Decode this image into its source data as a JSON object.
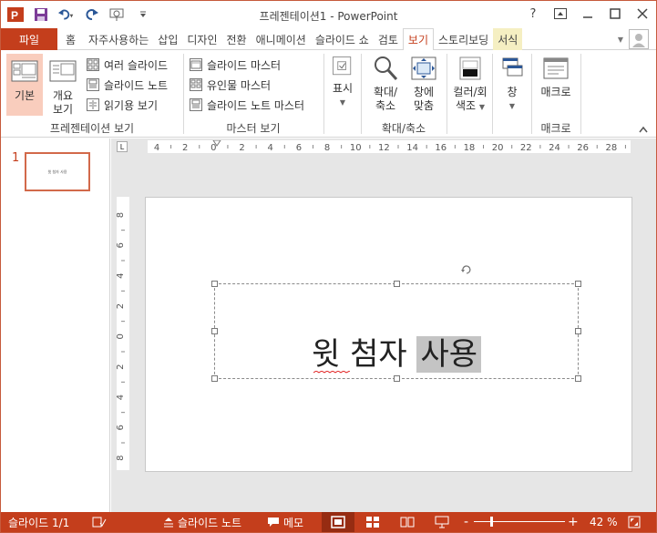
{
  "window": {
    "title": "프레젠테이션1 - PowerPoint",
    "help": "?",
    "controls": [
      "restore-ribbon",
      "minimize",
      "maximize",
      "close"
    ]
  },
  "tabs": {
    "file": "파일",
    "items": [
      {
        "label": "홈"
      },
      {
        "label": "자주사용하는"
      },
      {
        "label": "삽입"
      },
      {
        "label": "디자인"
      },
      {
        "label": "전환"
      },
      {
        "label": "애니메이션"
      },
      {
        "label": "슬라이드 쇼"
      },
      {
        "label": "검토"
      },
      {
        "label": "보기"
      },
      {
        "label": "스토리보딩"
      },
      {
        "label": "서식"
      }
    ],
    "active_index": 8
  },
  "ribbon": {
    "presentation_views": {
      "label": "프레젠테이션 보기",
      "normal": "기본",
      "outline_1": "개요",
      "outline_2": "보기",
      "slide_sorter": "여러 슬라이드",
      "notes_page": "슬라이드 노트",
      "reading_view": "읽기용 보기"
    },
    "master_views": {
      "label": "마스터 보기",
      "slide_master": "슬라이드 마스터",
      "handout_master": "유인물 마스터",
      "notes_master": "슬라이드 노트 마스터"
    },
    "show": {
      "label": "표시"
    },
    "zoom": {
      "label": "확대/축소",
      "zoom_1": "확대/",
      "zoom_2": "축소",
      "fit_1": "창에",
      "fit_2": "맞춤"
    },
    "color": {
      "label_1": "컬러/회",
      "label_2": "색조"
    },
    "window": {
      "label": "창"
    },
    "macros": {
      "button": "매크로",
      "label": "매크로"
    }
  },
  "slides_panel": {
    "number": "1",
    "thumb_text": "윗 첨자 사용"
  },
  "ruler": {
    "h_ticks": [
      "4",
      "2",
      "0",
      "2",
      "4",
      "6",
      "8",
      "10",
      "12",
      "14",
      "16",
      "18",
      "20",
      "22",
      "24",
      "26",
      "28"
    ],
    "v_ticks": [
      "8",
      "6",
      "4",
      "2",
      "0",
      "2",
      "4",
      "6",
      "8"
    ]
  },
  "slide": {
    "text_part1": "윗",
    "text_part2": "첨자",
    "text_part3": "사용"
  },
  "status": {
    "slide_count": "슬라이드 1/1",
    "notes": "슬라이드 노트",
    "comments": "메모",
    "zoom_minus": "-",
    "zoom_plus": "+",
    "zoom_level": "42 %",
    "zoom_fraction": 0.18
  }
}
